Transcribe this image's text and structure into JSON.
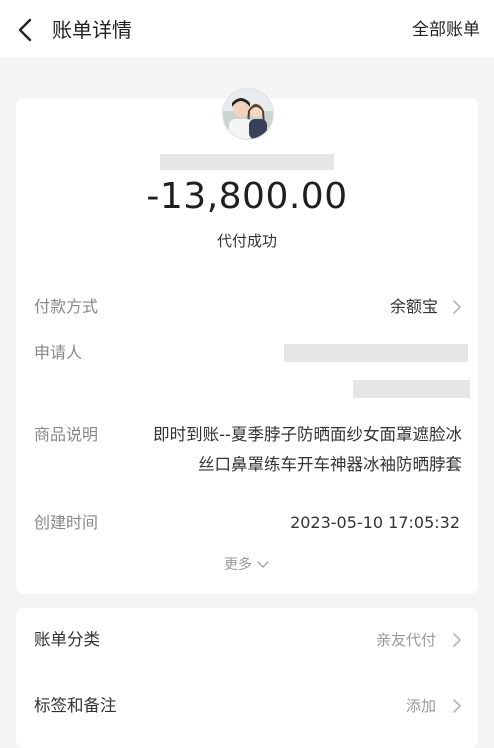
{
  "header": {
    "title": "账单详情",
    "right_action": "全部账单"
  },
  "bill": {
    "amount": "-13,800.00",
    "status": "代付成功",
    "more_label": "更多",
    "rows": {
      "payment_method": {
        "label": "付款方式",
        "value": "余额宝"
      },
      "applicant": {
        "label": "申请人"
      },
      "product_desc": {
        "label": "商品说明",
        "value_line1": "即时到账--夏季脖子防晒面纱女面罩遮脸冰",
        "value_line2": "丝口鼻罩练车开车神器冰袖防晒脖套"
      },
      "created_time": {
        "label": "创建时间",
        "value": "2023-05-10 17:05:32"
      }
    }
  },
  "extra": {
    "category": {
      "label": "账单分类",
      "value": "亲友代付"
    },
    "tags": {
      "label": "标签和备注",
      "value": "添加"
    }
  },
  "colors": {
    "background": "#f4f4f4",
    "card": "#ffffff",
    "label_gray": "#888888",
    "text_dark": "#333333"
  }
}
